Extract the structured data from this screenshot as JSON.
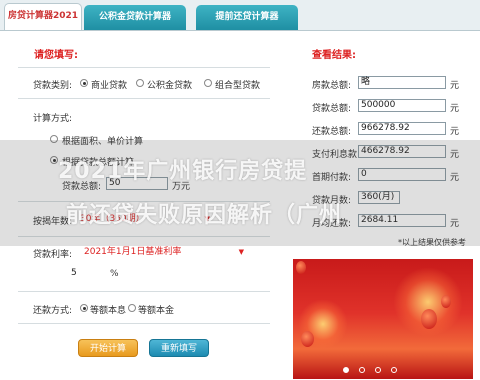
{
  "tabs": [
    {
      "label": "房贷计算器2021"
    },
    {
      "label": "公积金贷款计算器"
    },
    {
      "label": "提前还贷计算器"
    }
  ],
  "form": {
    "title": "请您填写:",
    "loan_type": {
      "label": "贷款类别:",
      "options": [
        "商业贷款",
        "公积金贷款",
        "组合型贷款"
      ],
      "selected": "商业贷款"
    },
    "calc_method": {
      "label": "计算方式:",
      "options": [
        "根据面积、单价计算",
        "根据贷款总额计算"
      ],
      "selected": "根据贷款总额计算",
      "amount_label": "贷款总额:",
      "amount_value": "50",
      "amount_unit": "万元"
    },
    "term": {
      "label": "按揭年数:",
      "value": "30年（360期）"
    },
    "rate": {
      "label": "贷款利率:",
      "select_value": "2021年1月1日基准利率",
      "value": "5",
      "unit": "%"
    },
    "repay": {
      "label": "还款方式:",
      "options": [
        "等额本息",
        "等额本金"
      ],
      "selected": "等额本息"
    },
    "buttons": {
      "start": "开始计算",
      "reset": "重新填写"
    }
  },
  "results": {
    "title": "查看结果:",
    "rows": [
      {
        "label": "房款总额:",
        "value": "略",
        "unit": "元"
      },
      {
        "label": "贷款总额:",
        "value": "500000",
        "unit": "元"
      },
      {
        "label": "还款总额:",
        "value": "966278.92",
        "unit": "元"
      },
      {
        "label": "支付利息款:",
        "value": "466278.92",
        "unit": "元"
      },
      {
        "label": "首期付款:",
        "value": "0",
        "unit": "元"
      },
      {
        "label": "贷款月数:",
        "value": "360(月)",
        "unit": ""
      },
      {
        "label": "月均还款:",
        "value": "2684.11",
        "unit": "元"
      }
    ],
    "note": "*以上结果仅供参考"
  },
  "watermark": {
    "line1": "2021年广州银行房贷提",
    "line2": "前还贷失败原因解析（广州"
  },
  "colors": {
    "accent": "#dd2222",
    "tab": "#1f8fa3"
  }
}
